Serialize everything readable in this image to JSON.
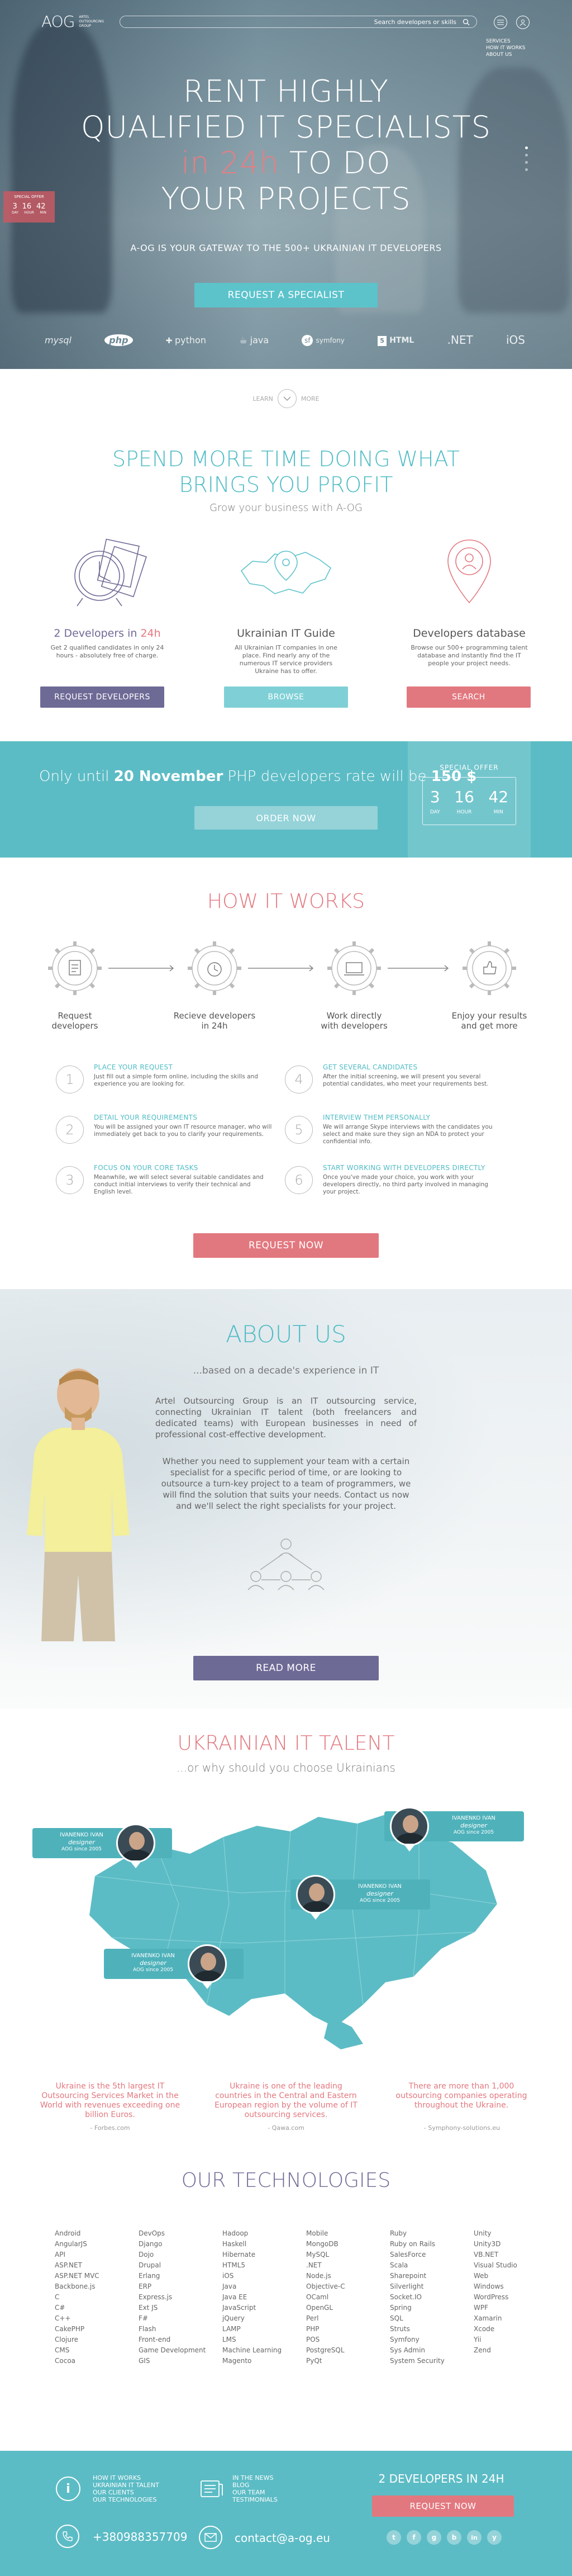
{
  "header": {
    "logo_text": "AOG",
    "logo_tagline": "ARTEL OUTSOURCING GROUP",
    "search_placeholder": "Search developers or skills",
    "nav": [
      "SERVICES",
      "HOW IT WORKS",
      "ABOUT US"
    ],
    "special_offer_label": "SPECIAL OFFER",
    "offer_values": [
      "3",
      "16",
      "42"
    ],
    "offer_units": [
      "DAY",
      "HOUR",
      "MIN"
    ]
  },
  "hero": {
    "title_line1": "RENT HIGHLY",
    "title_line2": "QUALIFIED IT SPECIALISTS",
    "title_accent": "in 24h",
    "title_line3_rest": " TO DO",
    "title_line4": "YOUR PROJECTS",
    "subtitle": "A-OG IS YOUR GATEWAY TO THE 500+ UKRAINIAN IT DEVELOPERS",
    "cta": "REQUEST A SPECIALIST",
    "tech_logos": [
      "mysql",
      "php",
      "python",
      "java",
      "symfony",
      "HTML",
      ".NET",
      "iOS"
    ],
    "learn_more_left": "LEARN",
    "learn_more_right": "MORE"
  },
  "benefits": {
    "title_line1": "SPEND MORE TIME DOING WHAT",
    "title_line2": "BRINGS YOU PROFIT",
    "subtitle": "Grow your business with A-OG",
    "items": [
      {
        "title": "2 Developers in ",
        "title_accent": "24h",
        "text": "Get 2 qualified candidates in only 24 hours - absolutely free of charge.",
        "button": "REQUEST DEVELOPERS"
      },
      {
        "title": "Ukrainian IT Guide",
        "title_accent": "",
        "text": "All Ukrainian IT companies in one place. Find nearly any of the numerous IT service providers Ukraine has to offer.",
        "button": "BROWSE"
      },
      {
        "title": "Developers database",
        "title_accent": "",
        "text": "Browse our 500+ programming talent database and instantly find the IT people your project needs.",
        "button": "SEARCH"
      }
    ]
  },
  "offer_band": {
    "text_before": "Only until ",
    "date": "20 November",
    "text_middle": " PHP developers rate will be ",
    "price": "150 $",
    "button": "ORDER NOW",
    "special_offer": "SPECIAL OFFER",
    "values": [
      "3",
      "16",
      "42"
    ],
    "units": [
      "DAY",
      "HOUR",
      "MIN"
    ]
  },
  "how_it_works": {
    "title": "HOW IT WORKS",
    "steps": [
      {
        "label_line1": "Request",
        "label_line2": "developers"
      },
      {
        "label_line1": "Recieve developers",
        "label_line2": "in 24h"
      },
      {
        "label_line1": "Work directly",
        "label_line2": "with developers"
      },
      {
        "label_line1": "Enjoy your results",
        "label_line2": "and get more"
      }
    ],
    "details": [
      {
        "num": "1",
        "title": "PLACE YOUR REQUEST",
        "text": "Just fill out a simple form online, including the skills and experience you are looking for."
      },
      {
        "num": "2",
        "title": "DETAIL YOUR REQUIREMENTS",
        "text": "You will be assigned your own IT resource manager, who will immediately get back to you to clarify your requirements."
      },
      {
        "num": "3",
        "title": "FOCUS ON YOUR CORE TASKS",
        "text": "Meanwhile, we will select several suitable candidates and conduct initial interviews to verify their technical and English level."
      },
      {
        "num": "4",
        "title": "GET SEVERAL CANDIDATES",
        "text": "After the initial screening, we will present you several potential candidates, who meet your requirements best."
      },
      {
        "num": "5",
        "title": "INTERVIEW THEM PERSONALLY",
        "text": "We will arrange Skype interviews with the candidates you select and make sure they sign an NDA to protect your confidential info."
      },
      {
        "num": "6",
        "title": "START WORKING WITH DEVELOPERS DIRECTLY",
        "text": "Once you've made your choice, you work with your developers directly, no third party involved in managing your project."
      }
    ],
    "button": "REQUEST NOW"
  },
  "about": {
    "title": "ABOUT US",
    "subtitle": "...based on a decade's experience in IT",
    "para1": "Artel Outsourcing Group is an IT outsourcing service, connecting Ukrainian IT talent (both freelancers and dedicated teams) with European businesses in need of professional cost-effective development.",
    "para2": "Whether you need to supplement your team with a certain specialist for a specific period of time, or are looking to outsource a turn-key project to a team of programmers, we will find the solution that suits your needs. Contact us now and we'll select the right specialists for your project.",
    "button": "READ MORE"
  },
  "talent": {
    "title": "UKRAINIAN IT TALENT",
    "subtitle": "...or why should you choose Ukrainians",
    "cards": [
      {
        "name": "IVANENKO IVAN",
        "role": "designer",
        "since": "AOG since 2005"
      },
      {
        "name": "IVANENKO IVAN",
        "role": "designer",
        "since": "AOG since 2005"
      },
      {
        "name": "IVANENKO IVAN",
        "role": "designer",
        "since": "AOG since 2005"
      },
      {
        "name": "IVANENKO IVAN",
        "role": "designer",
        "since": "AOG since 2005"
      }
    ],
    "facts": [
      {
        "text": "Ukraine is the 5th largest IT Outsourcing Services Market in the World with revenues exceeding one billion Euros.",
        "source": "- Forbes.com"
      },
      {
        "text": "Ukraine is one of the leading countries in the Central and Eastern European region by the volume of IT outsourcing services.",
        "source": "- Qawa.com"
      },
      {
        "text": "There are more than 1,000 outsourcing companies operating throughout the Ukraine.",
        "source": "- Symphony-solutions.eu"
      }
    ]
  },
  "technologies": {
    "title": "OUR TECHNOLOGIES",
    "columns": [
      [
        "Android",
        "AngularJS",
        "API",
        "ASP.NET",
        "ASP.NET MVC",
        "Backbone.js",
        "C",
        "C#",
        "C++",
        "CakePHP",
        "Clojure",
        "CMS",
        "Cocoa"
      ],
      [
        "DevOps",
        "Django",
        "Dojo",
        "Drupal",
        "Erlang",
        "ERP",
        "Express.js",
        "Ext JS",
        "F#",
        "Flash",
        "Front-end",
        "Game Development",
        "GIS"
      ],
      [
        "Hadoop",
        "Haskell",
        "Hibernate",
        "HTML5",
        "iOS",
        "Java",
        "Java EE",
        "JavaScript",
        "jQuery",
        "LAMP",
        "LMS",
        "Machine Learning",
        "Magento"
      ],
      [
        "Mobile",
        "MongoDB",
        "MySQL",
        ".NET",
        "Node.js",
        "Objective-C",
        "OCaml",
        "OpenGL",
        "Perl",
        "PHP",
        "POS",
        "PostgreSQL",
        "PyQt"
      ],
      [
        "Ruby",
        "Ruby on Rails",
        "SalesForce",
        "Scala",
        "Sharepoint",
        "Silverlight",
        "Socket.IO",
        "Spring",
        "SQL",
        "Struts",
        "Symfony",
        "Sys Admin",
        "System Security"
      ],
      [
        "Unity",
        "Unity3D",
        "VB.NET",
        "Visual Studio",
        "Web",
        "Windows",
        "WordPress",
        "WPF",
        "Xamarin",
        "Xcode",
        "Yii",
        "Zend",
        ""
      ]
    ]
  },
  "footer": {
    "links_col1": [
      "HOW IT WORKS",
      "UKRAINIAN IT TALENT",
      "OUR CLIENTS",
      "OUR TECHNOLOGIES"
    ],
    "links_col2": [
      "IN THE NEWS",
      "BLOG",
      "OUR TEAM",
      "TESTIMONIALS"
    ],
    "cta_title": "2 DEVELOPERS IN 24H",
    "cta_button": "REQUEST NOW",
    "phone": "+380988357709",
    "email": "contact@a-og.eu",
    "social": [
      "t",
      "f",
      "g",
      "b",
      "in",
      "y"
    ]
  }
}
